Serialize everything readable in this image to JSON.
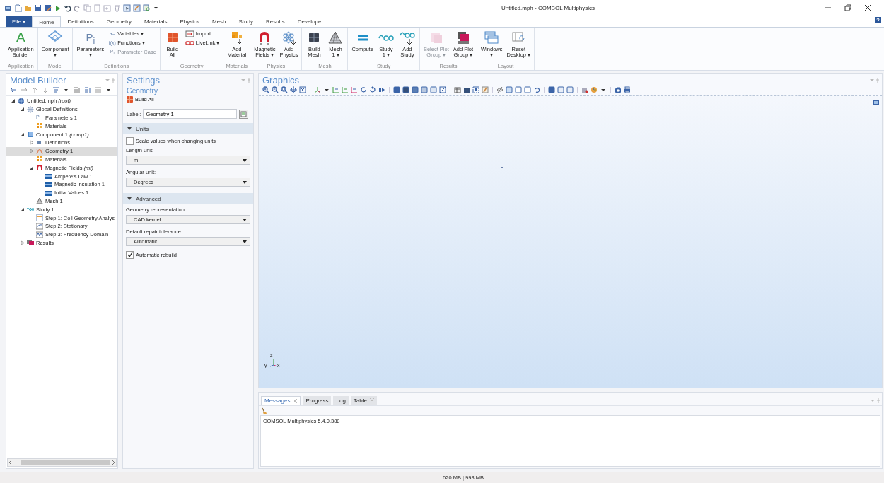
{
  "window": {
    "title": "Untitled.mph - COMSOL Multiphysics"
  },
  "ribbon_tabs": [
    {
      "label": "File ▾",
      "kind": "file",
      "selected": false
    },
    {
      "label": "Home",
      "kind": "tab",
      "selected": true
    },
    {
      "label": "Definitions",
      "kind": "tab",
      "selected": false
    },
    {
      "label": "Geometry",
      "kind": "tab",
      "selected": false
    },
    {
      "label": "Materials",
      "kind": "tab",
      "selected": false
    },
    {
      "label": "Physics",
      "kind": "tab",
      "selected": false
    },
    {
      "label": "Mesh",
      "kind": "tab",
      "selected": false
    },
    {
      "label": "Study",
      "kind": "tab",
      "selected": false
    },
    {
      "label": "Results",
      "kind": "tab",
      "selected": false
    },
    {
      "label": "Developer",
      "kind": "tab",
      "selected": false
    }
  ],
  "ribbon_groups": [
    {
      "label": "Application",
      "items": [
        {
          "kind": "large",
          "lines": [
            "Application",
            "Builder"
          ],
          "glyph": "A",
          "disabled": false
        }
      ]
    },
    {
      "label": "Model",
      "items": [
        {
          "kind": "large",
          "lines": [
            "Component",
            "▾"
          ],
          "disabled": false
        }
      ]
    },
    {
      "label": "Definitions",
      "items": [
        {
          "kind": "large",
          "lines": [
            "Parameters",
            "▾"
          ],
          "glyph": "P$_{i}$",
          "disabled": false
        },
        {
          "kind": "stack",
          "entries": [
            {
              "label": "Variables ▾",
              "glyph": "a=",
              "disabled": false
            },
            {
              "label": "Functions ▾",
              "glyph": "f(x)",
              "disabled": false
            },
            {
              "label": "Parameter Case",
              "glyph": "P$_{i}$",
              "disabled": true
            }
          ]
        }
      ]
    },
    {
      "label": "Geometry",
      "items": [
        {
          "kind": "large",
          "lines": [
            "Build",
            "All"
          ],
          "disabled": false
        },
        {
          "kind": "stack",
          "entries": [
            {
              "label": "Import",
              "disabled": false
            },
            {
              "label": "LiveLink ▾",
              "disabled": false
            }
          ]
        }
      ]
    },
    {
      "label": "Materials",
      "items": [
        {
          "kind": "large",
          "lines": [
            "Add",
            "Material"
          ],
          "disabled": false
        }
      ]
    },
    {
      "label": "Physics",
      "items": [
        {
          "kind": "large",
          "lines": [
            "Magnetic",
            "Fields ▾"
          ],
          "disabled": false
        },
        {
          "kind": "large",
          "lines": [
            "Add",
            "Physics"
          ],
          "disabled": false
        }
      ]
    },
    {
      "label": "Mesh",
      "items": [
        {
          "kind": "large",
          "lines": [
            "Build",
            "Mesh"
          ],
          "disabled": false
        },
        {
          "kind": "large",
          "lines": [
            "Mesh",
            "1 ▾"
          ],
          "disabled": false
        }
      ]
    },
    {
      "label": "Study",
      "items": [
        {
          "kind": "large",
          "lines": [
            "Compute"
          ],
          "disabled": false
        },
        {
          "kind": "large",
          "lines": [
            "Study",
            "1 ▾"
          ],
          "disabled": false
        },
        {
          "kind": "large",
          "lines": [
            "Add",
            "Study"
          ],
          "disabled": false
        }
      ]
    },
    {
      "label": "Results",
      "items": [
        {
          "kind": "large",
          "lines": [
            "Select Plot",
            "Group ▾"
          ],
          "disabled": true
        },
        {
          "kind": "large",
          "lines": [
            "Add Plot",
            "Group ▾"
          ],
          "disabled": false
        }
      ]
    },
    {
      "label": "Layout",
      "items": [
        {
          "kind": "large",
          "lines": [
            "Windows",
            "▾"
          ],
          "disabled": false
        },
        {
          "kind": "large",
          "lines": [
            "Reset",
            "Desktop ▾"
          ],
          "disabled": false
        }
      ]
    }
  ],
  "model_builder": {
    "title": "Model Builder",
    "tree": [
      {
        "label": "Untitled.mph *(root)*",
        "kind": "root",
        "expandable": true,
        "expanded": true,
        "selected": false,
        "children": [
          {
            "label": "Global Definitions",
            "kind": "global",
            "expandable": true,
            "expanded": true,
            "selected": false,
            "children": [
              {
                "label": "Parameters 1",
                "kind": "parameters",
                "glyph": "P$_{i}$",
                "expandable": false,
                "selected": false
              },
              {
                "label": "Materials",
                "kind": "materials",
                "expandable": false,
                "selected": false
              }
            ]
          },
          {
            "label": "Component 1 *(comp1)*",
            "kind": "component",
            "expandable": true,
            "expanded": true,
            "selected": false,
            "children": [
              {
                "label": "Definitions",
                "kind": "definitions",
                "expandable": true,
                "expanded": false,
                "selected": false
              },
              {
                "label": "Geometry 1",
                "kind": "geometry",
                "expandable": true,
                "expanded": false,
                "selected": true
              },
              {
                "label": "Materials",
                "kind": "materials",
                "expandable": false,
                "selected": false
              },
              {
                "label": "Magnetic Fields *(mf)*",
                "kind": "physics",
                "expandable": true,
                "expanded": true,
                "selected": false,
                "children": [
                  {
                    "label": "Ampère's Law 1",
                    "kind": "feature",
                    "expandable": false,
                    "selected": false
                  },
                  {
                    "label": "Magnetic Insulation 1",
                    "kind": "feature",
                    "expandable": false,
                    "selected": false
                  },
                  {
                    "label": "Initial Values 1",
                    "kind": "feature",
                    "expandable": false,
                    "selected": false
                  }
                ]
              },
              {
                "label": "Mesh 1",
                "kind": "mesh",
                "expandable": false,
                "selected": false
              }
            ]
          },
          {
            "label": "Study 1",
            "kind": "study",
            "expandable": true,
            "expanded": true,
            "selected": false,
            "children": [
              {
                "label": "Step 1: Coil Geometry Analys",
                "kind": "step-coil",
                "expandable": false,
                "selected": false
              },
              {
                "label": "Step 2: Stationary",
                "kind": "step-stationary",
                "expandable": false,
                "selected": false
              },
              {
                "label": "Step 3: Frequency Domain",
                "kind": "step-frequency",
                "expandable": false,
                "selected": false
              }
            ]
          },
          {
            "label": "Results",
            "kind": "results",
            "expandable": true,
            "expanded": false,
            "selected": false
          }
        ]
      }
    ]
  },
  "settings": {
    "title": "Settings",
    "subtitle": "Geometry",
    "build_button": "Build All",
    "label_field": {
      "label": "Label:",
      "value": "Geometry 1"
    },
    "sections": [
      {
        "title": "Units",
        "expanded": true,
        "fields": [
          {
            "kind": "checkbox",
            "label": "Scale values when changing units",
            "checked": false
          },
          {
            "kind": "select",
            "label": "Length unit:",
            "value": "m"
          },
          {
            "kind": "select",
            "label": "Angular unit:",
            "value": "Degrees"
          }
        ]
      },
      {
        "title": "Advanced",
        "expanded": true,
        "fields": [
          {
            "kind": "select",
            "label": "Geometry representation:",
            "value": "CAD kernel"
          },
          {
            "kind": "select",
            "label": "Default repair tolerance:",
            "value": "Automatic"
          },
          {
            "kind": "checkbox",
            "label": "Automatic rebuild",
            "checked": true
          }
        ]
      }
    ]
  },
  "graphics": {
    "title": "Graphics",
    "axis_labels": {
      "z": "z",
      "y": "y",
      "x": "x"
    }
  },
  "messages": {
    "tabs": [
      {
        "label": "Messages",
        "selected": true,
        "closable": true
      },
      {
        "label": "Progress",
        "selected": false,
        "closable": false
      },
      {
        "label": "Log",
        "selected": false,
        "closable": false
      },
      {
        "label": "Table",
        "selected": false,
        "closable": true
      }
    ],
    "lines": [
      "COMSOL Multiphysics 5.4.0.388"
    ]
  },
  "status_bar": {
    "memory": "620 MB | 993 MB"
  }
}
